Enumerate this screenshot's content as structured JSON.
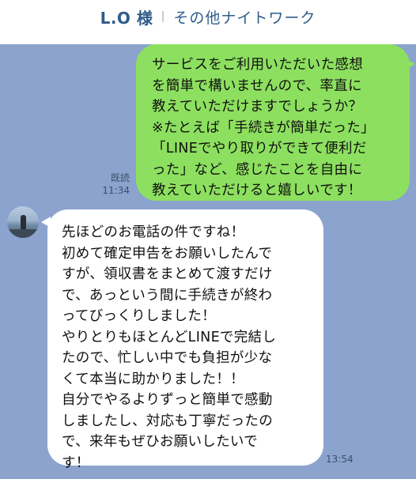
{
  "header": {
    "contact_name": "L.O 様",
    "category": "その他ナイトワーク"
  },
  "messages": {
    "outgoing": {
      "lines": [
        "サービスをご利用いただいた感想",
        "を簡単で構いませんので、率直に",
        "教えていただけますでしょうか？",
        "※たとえば「手続きが簡単だった」",
        "「LINEでやり取りができて便利だ",
        "った」など、感じたことを自由に",
        "教えていただけると嬉しいです！"
      ],
      "read_status": "既読",
      "time": "11:34"
    },
    "incoming": {
      "lines": [
        "先ほどのお電話の件ですね！",
        "初めて確定申告をお願いしたんで",
        "すが、領収書をまとめて渡すだけ",
        "で、あっという間に手続きが終わ",
        "ってびっくりしました！",
        "やりとりもほとんどLINEで完結し",
        "たので、忙しい中でも負担が少な",
        "くて本当に助かりました！！",
        "自分でやるよりずっと簡単で感動",
        "しましたし、対応も丁寧だったの",
        "で、来年もぜひお願いしたいで",
        "す！"
      ],
      "time": "13:54"
    }
  },
  "colors": {
    "chat_background": "#8ba3cd",
    "outgoing_bubble": "#8de05f",
    "incoming_bubble": "#ffffff",
    "header_text": "#2f5c8a"
  },
  "icons": {
    "avatar": "user-avatar-photo"
  }
}
